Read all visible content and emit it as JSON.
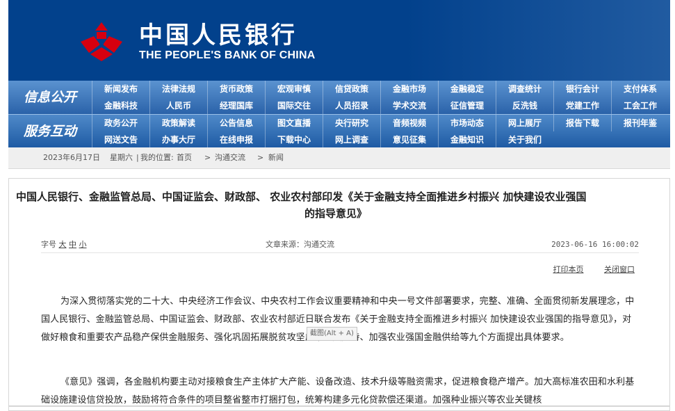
{
  "header": {
    "title_cn": "中国人民银行",
    "title_en": "THE PEOPLE'S BANK OF CHINA",
    "logo_icon": "pboc-logo-icon",
    "logo_color": "#d7000f",
    "bg_color": "#02418c"
  },
  "nav": {
    "group1_label": "信息公开",
    "group2_label": "服务互动",
    "group1_items": [
      "新闻发布",
      "法律法规",
      "货币政策",
      "宏观审慎",
      "信贷政策",
      "金融市场",
      "金融稳定",
      "调查统计",
      "银行会计",
      "支付体系",
      "金融科技",
      "人民币",
      "经理国库",
      "国际交往",
      "人员招录",
      "学术交流",
      "征信管理",
      "反洗钱",
      "党建工作",
      "工会工作"
    ],
    "group2_items": [
      "政务公开",
      "政策解读",
      "公告信息",
      "图文直播",
      "央行研究",
      "音频视频",
      "市场动态",
      "网上展厅",
      "报告下载",
      "报刊年鉴",
      "网送文告",
      "办事大厅",
      "在线申报",
      "下载中心",
      "网上调查",
      "意见征集",
      "金融知识",
      "关于我们"
    ]
  },
  "breadcrumb": {
    "date": "2023年6月17日",
    "weekday": "星期六",
    "location_label": "我的位置:",
    "home": "首页",
    "sep": ">",
    "level1": "沟通交流",
    "level2": "新闻"
  },
  "article": {
    "title_line1": "中国人民银行、金融监管总局、中国证监会、财政部、 农业农村部印发《关于金融支持全面推进乡村振兴 加快建设农业强国",
    "title_line2": "的指导意见》",
    "font_label": "字号",
    "font_large": "大",
    "font_medium": "中",
    "font_small": "小",
    "source": "文章来源：沟通交流",
    "datetime": "2023-06-16 16:00:02",
    "print_label": "打印本页",
    "close_label": "关闭窗口",
    "para1": "为深入贯彻落实党的二十大、中央经济工作会议、中央农村工作会议重要精神和中央一号文件部署要求，完整、准确、全面贯彻新发展理念，中国人民银行、金融监管总局、中国证监会、财政部、农业农村部近日联合发布《关于金融支持全面推进乡村振兴 加快建设农业强国的指导意见》，对做好粮食和重要农产品稳产保供金融服务、强化巩固拓展脱贫攻坚成果金融支持、加强农业强国金融供给等九个方面提出具体要求。",
    "para2": "《意见》强调，各金融机构要主动对接粮食生产主体扩大产能、设备改造、技术升级等融资需求，促进粮食稳产增产。加大高标准农田和水利基础设施建设信贷投放，鼓励将符合条件的项目整省整市打捆打包，统筹构建多元化贷款偿还渠道。加强种业振兴等农业关键核"
  },
  "tooltip": {
    "text": "截图(Alt + A)"
  }
}
